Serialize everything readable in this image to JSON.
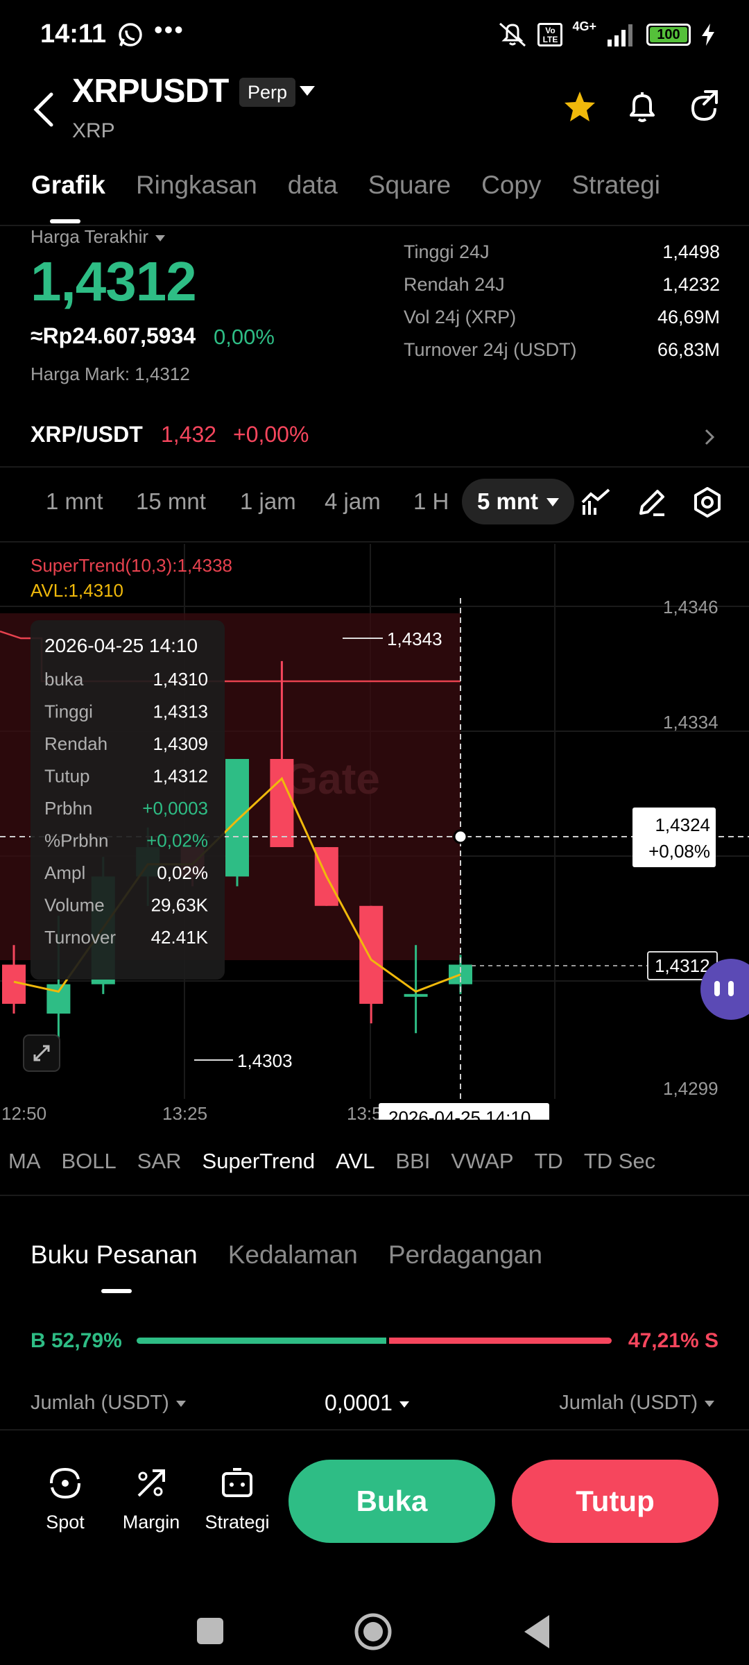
{
  "status_bar": {
    "time": "14:11",
    "dots": "•••",
    "battery": "100",
    "network": "4G+"
  },
  "header": {
    "symbol": "XRPUSDT",
    "badge": "Perp",
    "subtitle": "XRP"
  },
  "tabs": [
    "Grafik",
    "Ringkasan",
    "data",
    "Square",
    "Copy",
    "Strategi"
  ],
  "ticker": {
    "last_label": "Harga Terakhir",
    "last_price": "1,4312",
    "idr_price": "≈Rp24.607,5934",
    "change_pct": "0,00%",
    "mark_price": "Harga Mark: 1,4312",
    "stats": [
      {
        "k": "Tinggi 24J",
        "v": "1,4498"
      },
      {
        "k": "Rendah 24J",
        "v": "1,4232"
      },
      {
        "k": "Vol 24j (XRP)",
        "v": "46,69M"
      },
      {
        "k": "Turnover 24j (USDT)",
        "v": "66,83M"
      }
    ]
  },
  "spot_pair": {
    "name": "XRP/USDT",
    "price": "1,432",
    "change": "+0,00%"
  },
  "timeframes": [
    "1 mnt",
    "15 mnt",
    "1 jam",
    "4 jam",
    "1 H"
  ],
  "active_timeframe": "5 mnt",
  "chart": {
    "supertrend_label": "SuperTrend(10,3):1,4338",
    "avl_label": "AVL:1,4310",
    "y_ticks": [
      "1,4346",
      "1,4334",
      "1,4299"
    ],
    "x_ticks": [
      "12:50",
      "13:25",
      "13:5"
    ],
    "crosshair_time": "2026-04-25 14:10",
    "crosshair_price": "1,4324",
    "crosshair_pct": "+0,08%",
    "last_price_tag": "1,4312",
    "high_label": "1,4343",
    "low_label": "1,4303",
    "watermark": "Gate",
    "tooltip": {
      "time": "2026-04-25 14:10",
      "rows": [
        {
          "k": "buka",
          "v": "1,4310"
        },
        {
          "k": "Tinggi",
          "v": "1,4313"
        },
        {
          "k": "Rendah",
          "v": "1,4309"
        },
        {
          "k": "Tutup",
          "v": "1,4312"
        },
        {
          "k": "Prbhn",
          "v": "+0,0003"
        },
        {
          "k": "%Prbhn",
          "v": "+0,02%"
        },
        {
          "k": "Ampl",
          "v": "0,02%"
        },
        {
          "k": "Volume",
          "v": "29,63K"
        },
        {
          "k": "Turnover",
          "v": "42.41K"
        }
      ]
    },
    "colors": {
      "up": "#2ebd85",
      "down": "#f6465d",
      "supertrend": "#e8424f",
      "avl": "#f0b90b"
    }
  },
  "chart_data": {
    "type": "candlestick",
    "x": [
      "13:25",
      "13:30",
      "13:35",
      "13:40",
      "13:45",
      "13:50",
      "13:55",
      "14:00",
      "14:05",
      "14:10"
    ],
    "ohlc": [
      {
        "o": 1.4312,
        "h": 1.4314,
        "l": 1.4307,
        "c": 1.4308
      },
      {
        "o": 1.4307,
        "h": 1.4317,
        "l": 1.4303,
        "c": 1.431
      },
      {
        "o": 1.431,
        "h": 1.4323,
        "l": 1.4309,
        "c": 1.4321
      },
      {
        "o": 1.4321,
        "h": 1.4326,
        "l": 1.4318,
        "c": 1.4324
      },
      {
        "o": 1.4324,
        "h": 1.4324,
        "l": 1.432,
        "c": 1.4321
      },
      {
        "o": 1.4321,
        "h": 1.4333,
        "l": 1.432,
        "c": 1.4333
      },
      {
        "o": 1.4333,
        "h": 1.4343,
        "l": 1.4324,
        "c": 1.4324
      },
      {
        "o": 1.4324,
        "h": 1.4324,
        "l": 1.4318,
        "c": 1.4318
      },
      {
        "o": 1.4318,
        "h": 1.4318,
        "l": 1.4306,
        "c": 1.4308
      },
      {
        "o": 1.4309,
        "h": 1.4314,
        "l": 1.4305,
        "c": 1.4309
      },
      {
        "o": 1.431,
        "h": 1.4313,
        "l": 1.4309,
        "c": 1.4312
      }
    ],
    "ylim": [
      1.4299,
      1.435
    ],
    "supertrend": 1.4338,
    "avl": 1.431
  },
  "indicators": [
    "MA",
    "BOLL",
    "SAR",
    "SuperTrend",
    "AVL",
    "BBI",
    "VWAP",
    "TD",
    "TD Sec"
  ],
  "orderbook": {
    "tabs": [
      "Buku Pesanan",
      "Kedalaman",
      "Perdagangan"
    ],
    "buy_label": "B 52,79%",
    "sell_label": "47,21% S",
    "buy_pct": 52.79,
    "qty_left": "Jumlah (USDT)",
    "qty_mid": "0,0001",
    "qty_right": "Jumlah (USDT)"
  },
  "bottom_nav": [
    {
      "label": "Spot",
      "icon": "spot-icon"
    },
    {
      "label": "Margin",
      "icon": "margin-icon"
    },
    {
      "label": "Strategi",
      "icon": "strategy-icon"
    }
  ],
  "actions": {
    "open": "Buka",
    "close": "Tutup"
  }
}
